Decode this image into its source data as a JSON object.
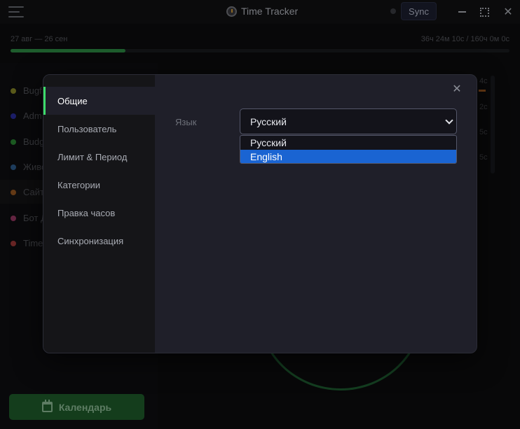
{
  "window": {
    "title": "Time Tracker",
    "sync_label": "Sync",
    "close_symbol": "✕"
  },
  "period": {
    "range": "27 авг — 26 сен",
    "total": "36ч 24м 10с / 160ч 0м 0с",
    "progress_fraction": 0.23
  },
  "projects": [
    {
      "label": "Bugf",
      "color": "#8a8a2a"
    },
    {
      "label": "Adm",
      "color": "#2b2fa0"
    },
    {
      "label": "Budg",
      "color": "#2c8a35"
    },
    {
      "label": "Живо",
      "color": "#2f5f8f"
    },
    {
      "label": "Сайт",
      "color": "#9a5a22"
    },
    {
      "label": "Бот Д",
      "color": "#9a3a66"
    },
    {
      "label": "Time",
      "color": "#a03a3a"
    }
  ],
  "right_column": [
    "4с",
    "2с",
    "5с",
    "5с"
  ],
  "calendar_label": "Календарь",
  "settings": {
    "close_symbol": "✕",
    "nav": [
      {
        "label": "Общие",
        "active": true
      },
      {
        "label": "Пользователь",
        "active": false
      },
      {
        "label": "Лимит & Период",
        "active": false
      },
      {
        "label": "Категории",
        "active": false
      },
      {
        "label": "Правка часов",
        "active": false
      },
      {
        "label": "Синхронизация",
        "active": false
      }
    ],
    "language": {
      "label": "Язык",
      "current": "Русский",
      "options": [
        "Русский",
        "English"
      ],
      "highlighted_option": "English"
    }
  }
}
